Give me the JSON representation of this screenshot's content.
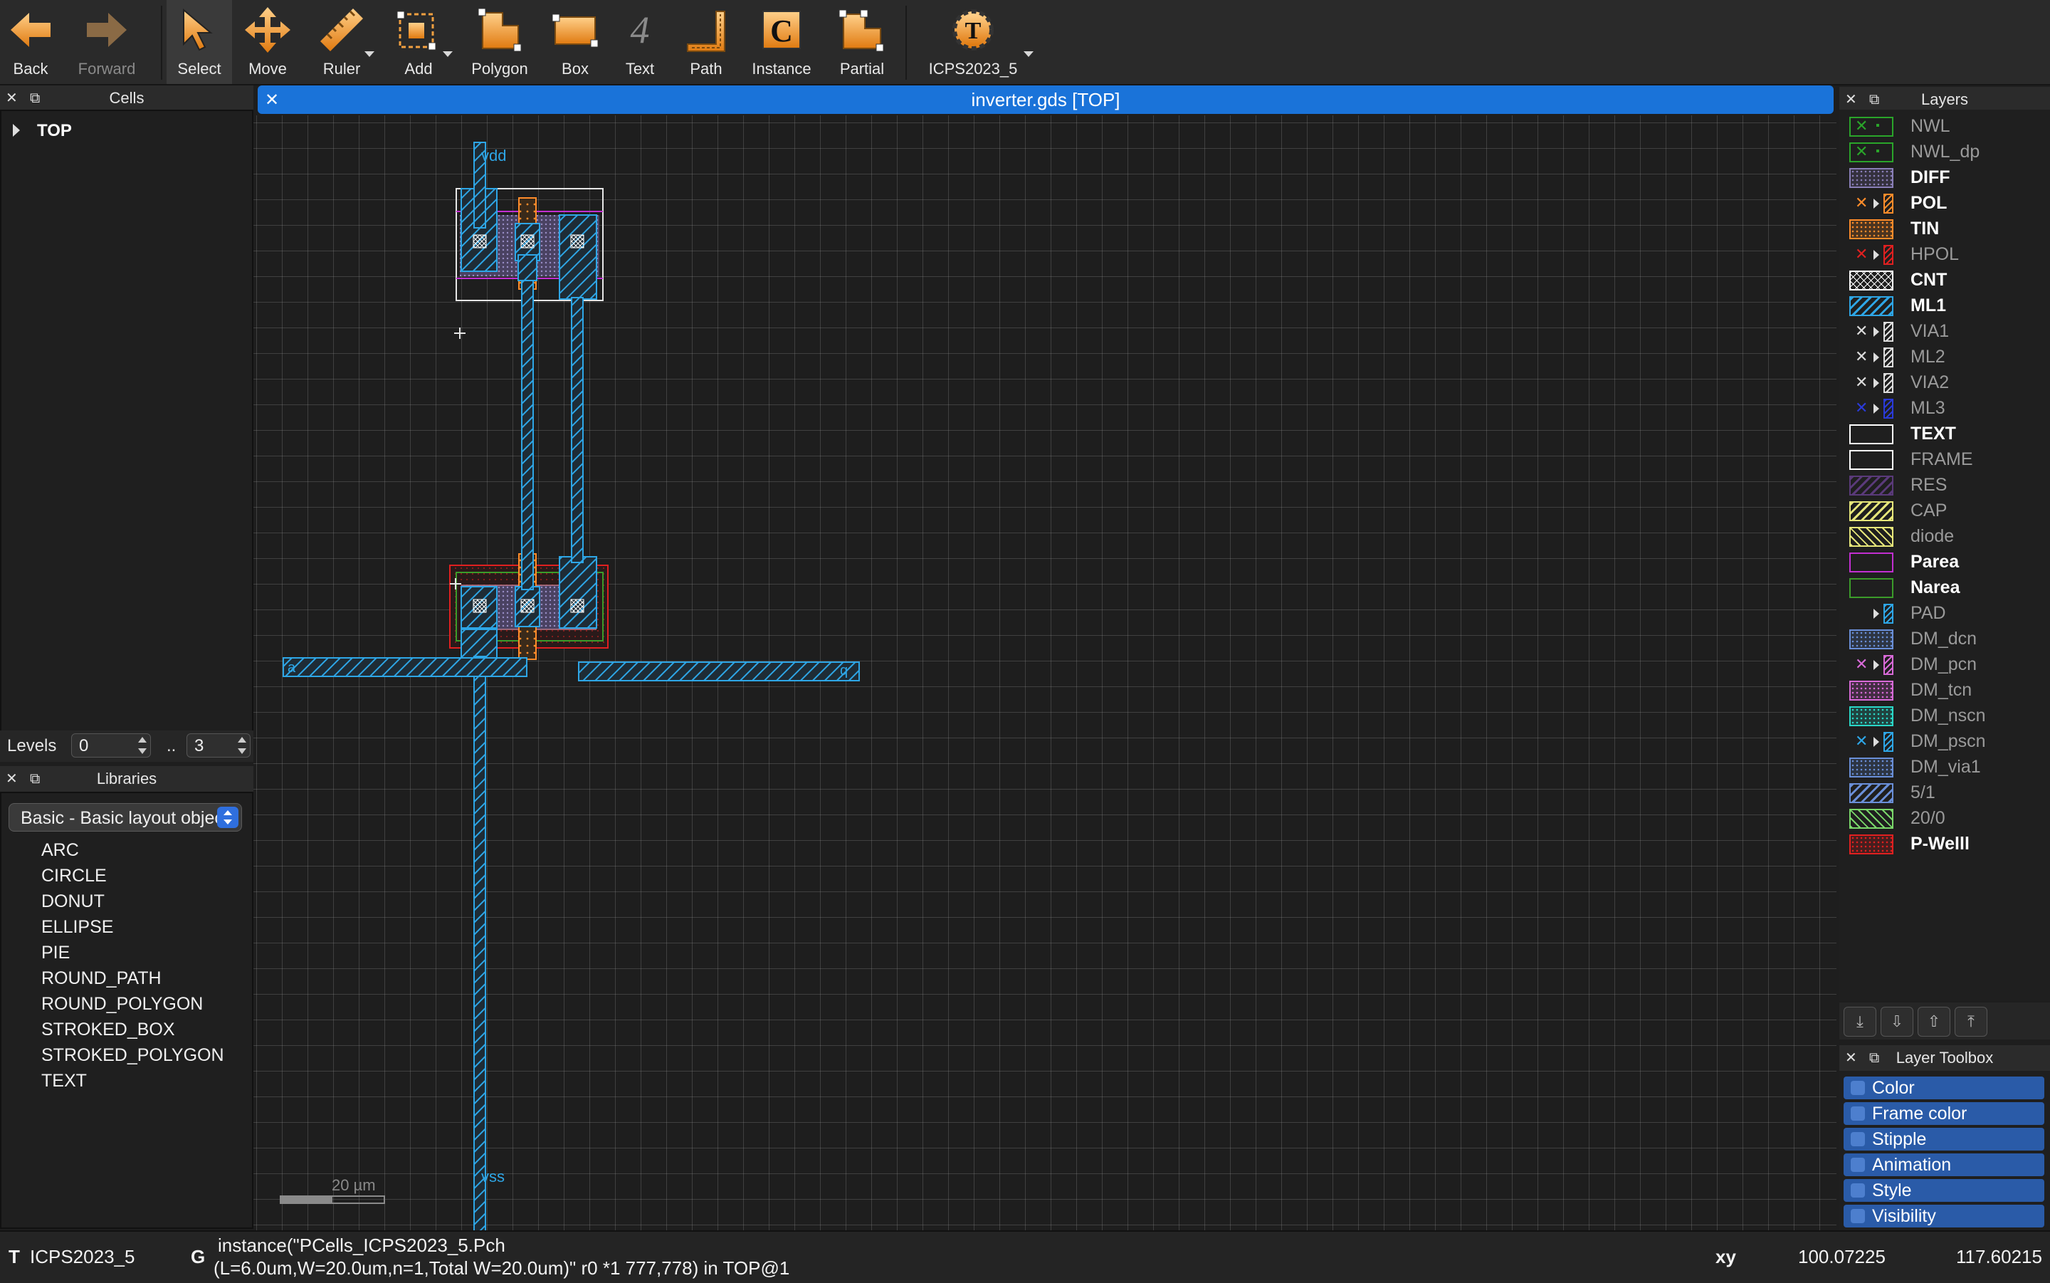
{
  "toolbar": {
    "items": [
      {
        "label": "Back",
        "icon": "back-arrow-icon"
      },
      {
        "label": "Forward",
        "icon": "forward-arrow-icon"
      },
      {
        "label": "Select",
        "icon": "select-arrow-icon"
      },
      {
        "label": "Move",
        "icon": "move-cross-icon"
      },
      {
        "label": "Ruler",
        "icon": "ruler-icon"
      },
      {
        "label": "Add",
        "icon": "add-icon"
      },
      {
        "label": "Polygon",
        "icon": "polygon-icon"
      },
      {
        "label": "Box",
        "icon": "box-icon"
      },
      {
        "label": "Text",
        "icon": "text-4-icon"
      },
      {
        "label": "Path",
        "icon": "path-icon"
      },
      {
        "label": "Instance",
        "icon": "instance-c-icon"
      },
      {
        "label": "Partial",
        "icon": "partial-icon"
      },
      {
        "label": "ICPS2023_5",
        "icon": "tech-t-gear-icon"
      }
    ],
    "icon_glyphs": {
      "text": "4",
      "instance": "C",
      "tech": "T"
    }
  },
  "cells_panel": {
    "title": "Cells",
    "tree": [
      {
        "label": "TOP"
      }
    ]
  },
  "levels": {
    "label": "Levels",
    "min": "0",
    "sep": "..",
    "max": "3"
  },
  "libraries_panel": {
    "title": "Libraries",
    "selected": "Basic - Basic layout objects",
    "items": [
      "ARC",
      "CIRCLE",
      "DONUT",
      "ELLIPSE",
      "PIE",
      "ROUND_PATH",
      "ROUND_POLYGON",
      "STROKED_BOX",
      "STROKED_POLYGON",
      "TEXT"
    ]
  },
  "document": {
    "tab_title": "inverter.gds [TOP]",
    "close": "✕"
  },
  "canvas": {
    "labels": {
      "vdd": "vdd",
      "vss": "vss",
      "a": "a",
      "q": "q"
    },
    "scale_bar": "20 µm",
    "colors": {
      "ml1": "#2ea6e6",
      "pol": "#ff8c2a",
      "diff": "#6b5f8a",
      "parea": "#c22fd1",
      "pwell": "#e02020",
      "narea": "#3b9c2a",
      "frame": "#e6e6e6"
    }
  },
  "layers_panel": {
    "title": "Layers",
    "layers": [
      {
        "name": "NWL",
        "visible": false,
        "color": "#2aa52a",
        "fill": "none",
        "icon": "xdot"
      },
      {
        "name": "NWL_dp",
        "visible": false,
        "color": "#2aa52a",
        "fill": "none",
        "icon": "xdot"
      },
      {
        "name": "DIFF",
        "visible": true,
        "color": "#8a7fb8",
        "fill": "dots"
      },
      {
        "name": "POL",
        "visible": true,
        "color": "#ff8c2a",
        "fill": "none",
        "icon": "xtri"
      },
      {
        "name": "TIN",
        "visible": true,
        "color": "#ff8c2a",
        "fill": "dots"
      },
      {
        "name": "HPOL",
        "visible": false,
        "color": "#e02020",
        "fill": "none",
        "icon": "xtri"
      },
      {
        "name": "CNT",
        "visible": true,
        "color": "#ffffff",
        "fill": "cross"
      },
      {
        "name": "ML1",
        "visible": true,
        "color": "#2ea6e6",
        "fill": "diag"
      },
      {
        "name": "VIA1",
        "visible": false,
        "color": "#dddddd",
        "fill": "none",
        "icon": "xtri"
      },
      {
        "name": "ML2",
        "visible": false,
        "color": "#dddddd",
        "fill": "none",
        "icon": "xtri"
      },
      {
        "name": "VIA2",
        "visible": false,
        "color": "#dddddd",
        "fill": "none",
        "icon": "xtri"
      },
      {
        "name": "ML3",
        "visible": false,
        "color": "#2a3ad8",
        "fill": "none",
        "icon": "xtri"
      },
      {
        "name": "TEXT",
        "visible": true,
        "color": "#ffffff",
        "fill": "none"
      },
      {
        "name": "FRAME",
        "visible": false,
        "color": "#ffffff",
        "fill": "none"
      },
      {
        "name": "RES",
        "visible": false,
        "color": "#5a3a7a",
        "fill": "diag"
      },
      {
        "name": "CAP",
        "visible": false,
        "color": "#e6e67a",
        "fill": "diag"
      },
      {
        "name": "diode",
        "visible": false,
        "color": "#e6e67a",
        "fill": "diag2"
      },
      {
        "name": "Parea",
        "visible": true,
        "color": "#c22fd1",
        "fill": "none"
      },
      {
        "name": "Narea",
        "visible": true,
        "color": "#3b9c2a",
        "fill": "none"
      },
      {
        "name": "PAD",
        "visible": false,
        "color": "#2ea6e6",
        "fill": "none",
        "icon": "tri"
      },
      {
        "name": "DM_dcn",
        "visible": false,
        "color": "#6a8fd8",
        "fill": "dots"
      },
      {
        "name": "DM_pcn",
        "visible": false,
        "color": "#d86ad8",
        "fill": "none",
        "icon": "xtri"
      },
      {
        "name": "DM_tcn",
        "visible": false,
        "color": "#d86ad8",
        "fill": "dots"
      },
      {
        "name": "DM_nscn",
        "visible": false,
        "color": "#2ad8c8",
        "fill": "dots"
      },
      {
        "name": "DM_pscn",
        "visible": false,
        "color": "#2ea6e6",
        "fill": "none",
        "icon": "xtri"
      },
      {
        "name": "DM_via1",
        "visible": false,
        "color": "#6a8fd8",
        "fill": "dots"
      },
      {
        "name": "5/1",
        "visible": false,
        "color": "#6a8fd8",
        "fill": "diag"
      },
      {
        "name": "20/0",
        "visible": false,
        "color": "#7ad86a",
        "fill": "diag2"
      },
      {
        "name": "P-Welll",
        "visible": true,
        "color": "#e02020",
        "fill": "dots"
      }
    ]
  },
  "layer_buttons": [
    "down-to-bottom-icon",
    "down-icon",
    "up-icon",
    "up-to-top-icon"
  ],
  "layer_toolbox": {
    "title": "Layer Toolbox",
    "items": [
      "Color",
      "Frame color",
      "Stipple",
      "Animation",
      "Style",
      "Visibility"
    ]
  },
  "status": {
    "tech_prefix": "T",
    "tech": "ICPS2023_5",
    "sel_prefix": "G",
    "message_line1": "instance(\"PCells_ICPS2023_5.Pch",
    "message_line2": "(L=6.0um,W=20.0um,n=1,Total W=20.0um)\" r0 *1 777,778) in TOP@1",
    "xy_label": "xy",
    "x": "100.07225",
    "y": "117.60215"
  },
  "panel_buttons": {
    "close": "✕",
    "float": "⧉"
  }
}
